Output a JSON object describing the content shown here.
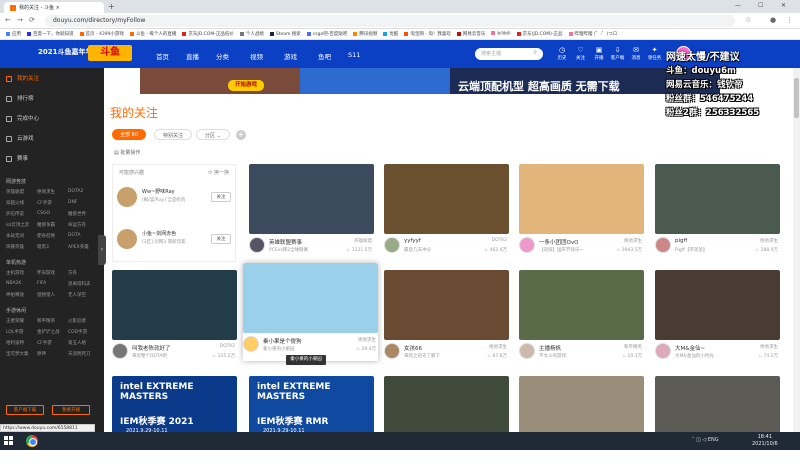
{
  "browser": {
    "tab_title": "我的关注 - 斗鱼",
    "url": "douyu.com/directory/myFollow",
    "bookmarks": [
      "应用",
      "百度一下，你就知道",
      "首页 - 4399小游戏",
      "斗鱼 - 每个人的直播",
      "京东JD.COM-正品低价",
      "个人战绩",
      "Steam 搜索",
      "csgo吧-百度贴吧",
      "腾讯视频",
      "优酷",
      "淘宝网 - 淘！我喜欢",
      "网易云音乐",
      "bilibili",
      "京东(JD.COM)-正品",
      "哔哩哔哩 (゜-゜)つロ"
    ]
  },
  "header": {
    "logo": "2021斗鱼嘉年华",
    "logo2": "斗鱼",
    "nav": [
      "首页",
      "直播",
      "分类",
      "视频",
      "游戏",
      "鱼吧",
      "S11"
    ],
    "search_placeholder": "搜索主播",
    "icons": [
      {
        "label": "历史",
        "icon": "clock-icon",
        "glyph": "◷"
      },
      {
        "label": "关注",
        "icon": "heart-icon",
        "glyph": "♡"
      },
      {
        "label": "开播",
        "icon": "camera-icon",
        "glyph": "▣"
      },
      {
        "label": "客户端",
        "icon": "download-icon",
        "glyph": "⇩"
      },
      {
        "label": "消息",
        "icon": "bell-icon",
        "glyph": "✉"
      },
      {
        "label": "领任务",
        "icon": "gift-icon",
        "glyph": "✦"
      }
    ],
    "banner_btn": "开始游戏",
    "banner_slogan": "云端顶配机型 超高画质 无需下载"
  },
  "overlay": {
    "title": "网速太慢/不建议",
    "lines": [
      "斗鱼：douyu6m",
      "网易云音乐：钱钦帝",
      "粉丝群：546475244",
      "粉丝2群：256332565"
    ]
  },
  "sidebar": {
    "main": [
      {
        "label": "我的关注",
        "active": true
      },
      {
        "label": "排行榜",
        "active": false
      },
      {
        "label": "完成中心",
        "active": false
      },
      {
        "label": "云游戏",
        "active": false
      },
      {
        "label": "赛事",
        "active": false
      }
    ],
    "sections": [
      {
        "title": "网游竞技",
        "items": [
          "英雄联盟",
          "绝地求生",
          "DOTA2",
          "穿越火线",
          "CF手游",
          "DNF",
          "炉石传说",
          "CSGO",
          "魔兽世界",
          "lol云顶之弈",
          "魔兽争霸",
          "命运方舟",
          "永劫无间",
          "使命召唤",
          "DOTA",
          "风暴英雄",
          "暗黑3",
          "APEX英雄"
        ]
      },
      {
        "title": "单机热游",
        "items": [
          "主机游戏",
          "怀旧游戏",
          "方舟",
          "NBA2K",
          "FIFA",
          "逃离塔科夫",
          "神佑释放",
          "怪物猎人",
          "无人深空"
        ]
      },
      {
        "title": "手游休闲",
        "items": [
          "王者荣耀",
          "和平精英",
          "火影忍者",
          "LOL手游",
          "金铲铲之战",
          "COD手游",
          "哈利波特",
          "CF手游",
          "第五人格",
          "宝可梦大集",
          "原神",
          "天涯明月刀"
        ]
      }
    ],
    "btn_client": "客户端下载",
    "btn_live": "我要开播"
  },
  "main": {
    "title": "我的关注",
    "filters": [
      "全部 60",
      "特别关注",
      "分区"
    ],
    "batch": "批量操作",
    "recommend": {
      "header": "可能感兴趣",
      "refresh": "换一换",
      "items": [
        {
          "name": "Ww~野味Ray",
          "desc": "[枫/蓝/Ray] 全是奶鸡",
          "follow": "关注"
        },
        {
          "name": "小鱼~剑网赤色",
          "desc": "[3区] 剑网3 萌新玩家",
          "follow": "关注"
        }
      ]
    },
    "cards": [
      {
        "name": "英雄联盟赛事",
        "cat": "英雄联盟",
        "title": "PCEvs韩2全球联赛",
        "views": "1121.5万",
        "color": "#3b4a5c",
        "av": "#556"
      },
      {
        "name": "yyfyyf",
        "cat": "DOTA2",
        "title": "最后几天冲分",
        "views": "462.4万",
        "color": "#6b5030",
        "av": "#9a8"
      },
      {
        "name": "一条小团团OvO",
        "cat": "绝地求生",
        "title": "【双排】国庆节快乐~",
        "views": "3943.5万",
        "color": "#e2b57a",
        "av": "#e9c"
      },
      {
        "name": "pigff",
        "cat": "绝地求生",
        "title": "Pigff【带弟弟】",
        "views": "288.9万",
        "color": "#4a5a4f",
        "av": "#c88"
      },
      {
        "name": "叫我老陈就好了",
        "cat": "DOTA2",
        "title": "来玩整个DOTA吧",
        "views": "125.2万",
        "color": "#243b4a",
        "av": "#777"
      },
      {
        "name": "秦小果是个傻狗",
        "cat": "绝地求生",
        "title": "秦小果的小果园",
        "views": "29.4万",
        "color": "#9ad0ea",
        "av": "#fc6"
      },
      {
        "name": "女孩66",
        "cat": "绝地求生",
        "title": "来玩之前先了解下",
        "views": "87.6万",
        "color": "#6a4a33",
        "av": "#a86"
      },
      {
        "name": "主播杨帆",
        "cat": "和平精英",
        "title": "不文斗的游戏",
        "views": "10.3万",
        "color": "#5a6b4a",
        "av": "#cba"
      },
      {
        "name": "大M&金仙~",
        "cat": "绝地求生",
        "title": "大M&金仙的小时光",
        "views": "74.2万",
        "color": "#4a3b33",
        "av": "#dab"
      },
      {
        "name": "IEM秋季赛 2021",
        "cat": "",
        "title": "",
        "views": "",
        "color": "#0b3a8a",
        "av": ""
      },
      {
        "name": "IEM秋季赛 RMR",
        "cat": "",
        "title": "",
        "views": "",
        "color": "#0f4aa0",
        "av": ""
      },
      {
        "name": "",
        "cat": "",
        "title": "",
        "views": "",
        "color": "#3f4a3a",
        "av": ""
      },
      {
        "name": "",
        "cat": "",
        "title": "",
        "views": "",
        "color": "#9a8e7a",
        "av": ""
      },
      {
        "name": "",
        "cat": "",
        "title": "",
        "views": "",
        "color": "#5b5a55",
        "av": ""
      }
    ],
    "intel": {
      "line1": "intel EXTREME MASTERS",
      "date": "2021.9.29-10.11"
    },
    "tooltip": "秦小果的小果园"
  },
  "status_url": "https://www.douyu.com/6558811",
  "taskbar": {
    "lang": "ENG",
    "time": "18:41",
    "date": "2021/10/6"
  }
}
